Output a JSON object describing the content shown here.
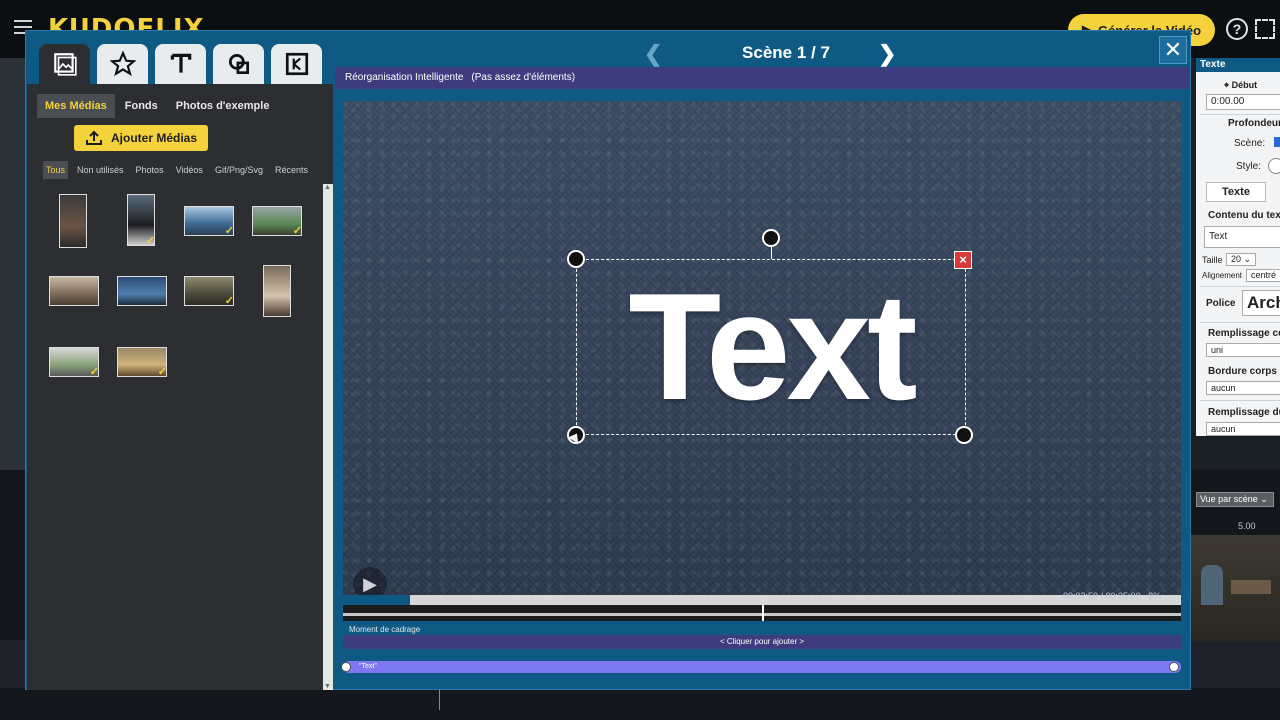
{
  "app": {
    "logo": "KUDOFLIX",
    "generate_button": "Générer la Vidéo"
  },
  "modal": {
    "scene_title": "Scène 1 / 7",
    "close": "✕"
  },
  "left_panel": {
    "subtabs": [
      "Mes Médias",
      "Fonds",
      "Photos d'exemple"
    ],
    "add_media": "Ajouter Médias",
    "filters": [
      "Tous",
      "Non utilisés",
      "Photos",
      "Vidéos",
      "Gif/Png/Svg",
      "Récents"
    ]
  },
  "editor": {
    "info_label": "Réorganisation Intelligente",
    "info_note": "(Pas assez d'éléments)",
    "canvas_text": "Text",
    "time_display": "00:02:50 / 00:35:00",
    "progress_percent": "8%",
    "progress_fraction": 0.08,
    "moment_label": "Moment de cadrage",
    "add_label": "< Cliquer pour ajouter >",
    "element_label": "\"Text\""
  },
  "properties": {
    "header": "Texte",
    "debut_label": "Début",
    "debut_value": "0:00.00",
    "profondeur_label": "Profondeur",
    "scene_label": "Scène:",
    "style_label": "Style:",
    "tab_texte": "Texte",
    "contenu_label": "Contenu du texte",
    "contenu_value": "Text",
    "taille_label": "Taille",
    "taille_value": "20",
    "alignement_label": "Alignement",
    "alignement_value": "centré",
    "police_label": "Police",
    "police_value": "Arch",
    "remplissage_corps_label": "Remplissage co",
    "remplissage_corps_value": "uni",
    "bordure_label": "Bordure corps d",
    "bordure_value": "aucun",
    "remplissage_du_label": "Remplissage du",
    "remplissage_du_value": "aucun"
  },
  "timeline_right": {
    "view_select": "Vue par scène",
    "ruler_value": "5.00"
  },
  "colors": {
    "accent_yellow": "#f3d23b",
    "modal_blue": "#0f5a85",
    "purple": "#3d3c7e",
    "track_purple": "#7d78f0"
  }
}
